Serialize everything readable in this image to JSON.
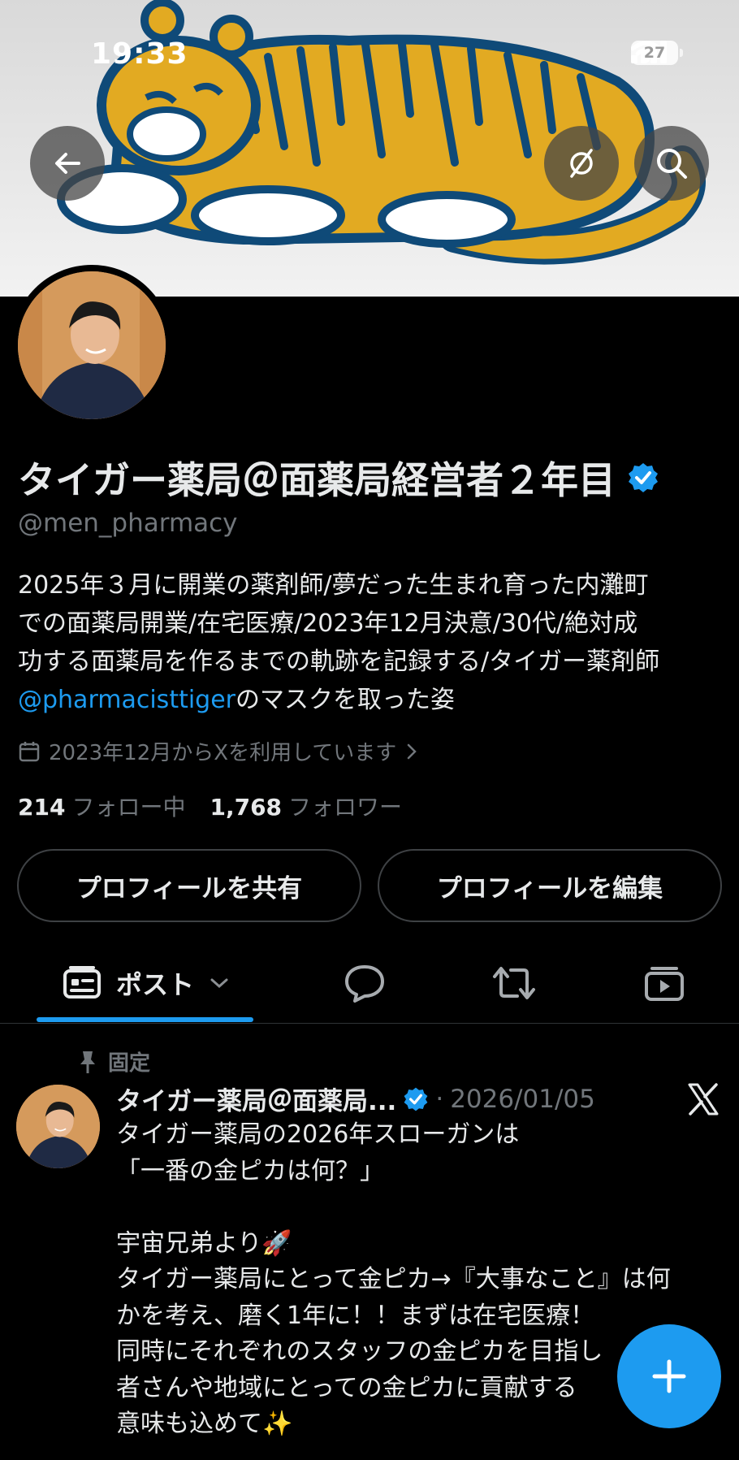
{
  "status_bar": {
    "time": "19:33",
    "battery": "27"
  },
  "profile": {
    "name": "タイガー薬局＠面薬局経営者２年目",
    "handle": "@men_pharmacy",
    "bio_line1": "2025年３月に開業の薬剤師/夢だった生まれ育った内灘町",
    "bio_line2": "での面薬局開業/在宅医療/2023年12月決意/30代/絶対成",
    "bio_line3": "功する面薬局を作るまでの軌跡を記録する/タイガー薬剤師",
    "bio_mention": "@pharmacisttiger",
    "bio_line4_rest": "のマスクを取った姿",
    "joined": "2023年12月からXを利用しています",
    "following_count": "214",
    "following_label": "フォロー中",
    "followers_count": "1,768",
    "followers_label": "フォロワー"
  },
  "buttons": {
    "share_profile": "プロフィールを共有",
    "edit_profile": "プロフィールを編集"
  },
  "tabs": {
    "posts_label": "ポスト"
  },
  "post": {
    "pinned_label": "固定",
    "author": "タイガー薬局＠面薬局...",
    "separator": "·",
    "date": "2026/01/05",
    "body": "タイガー薬局の2026年スローガンは\n「一番の金ピカは何？」\n\n宇宙兄弟より🚀\nタイガー薬局にとって金ピカ→『大事なこと』は何\nかを考え、磨く1年に！！まずは在宅医療！\n同時にそれぞれのスタッフの金ピカを目指し\n者さんや地域にとっての金ピカに貢献する\n意味も込めて✨"
  },
  "colors": {
    "accent": "#1d9bf0",
    "tiger_yellow": "#e2aa22",
    "tiger_outline": "#0f4a78"
  }
}
